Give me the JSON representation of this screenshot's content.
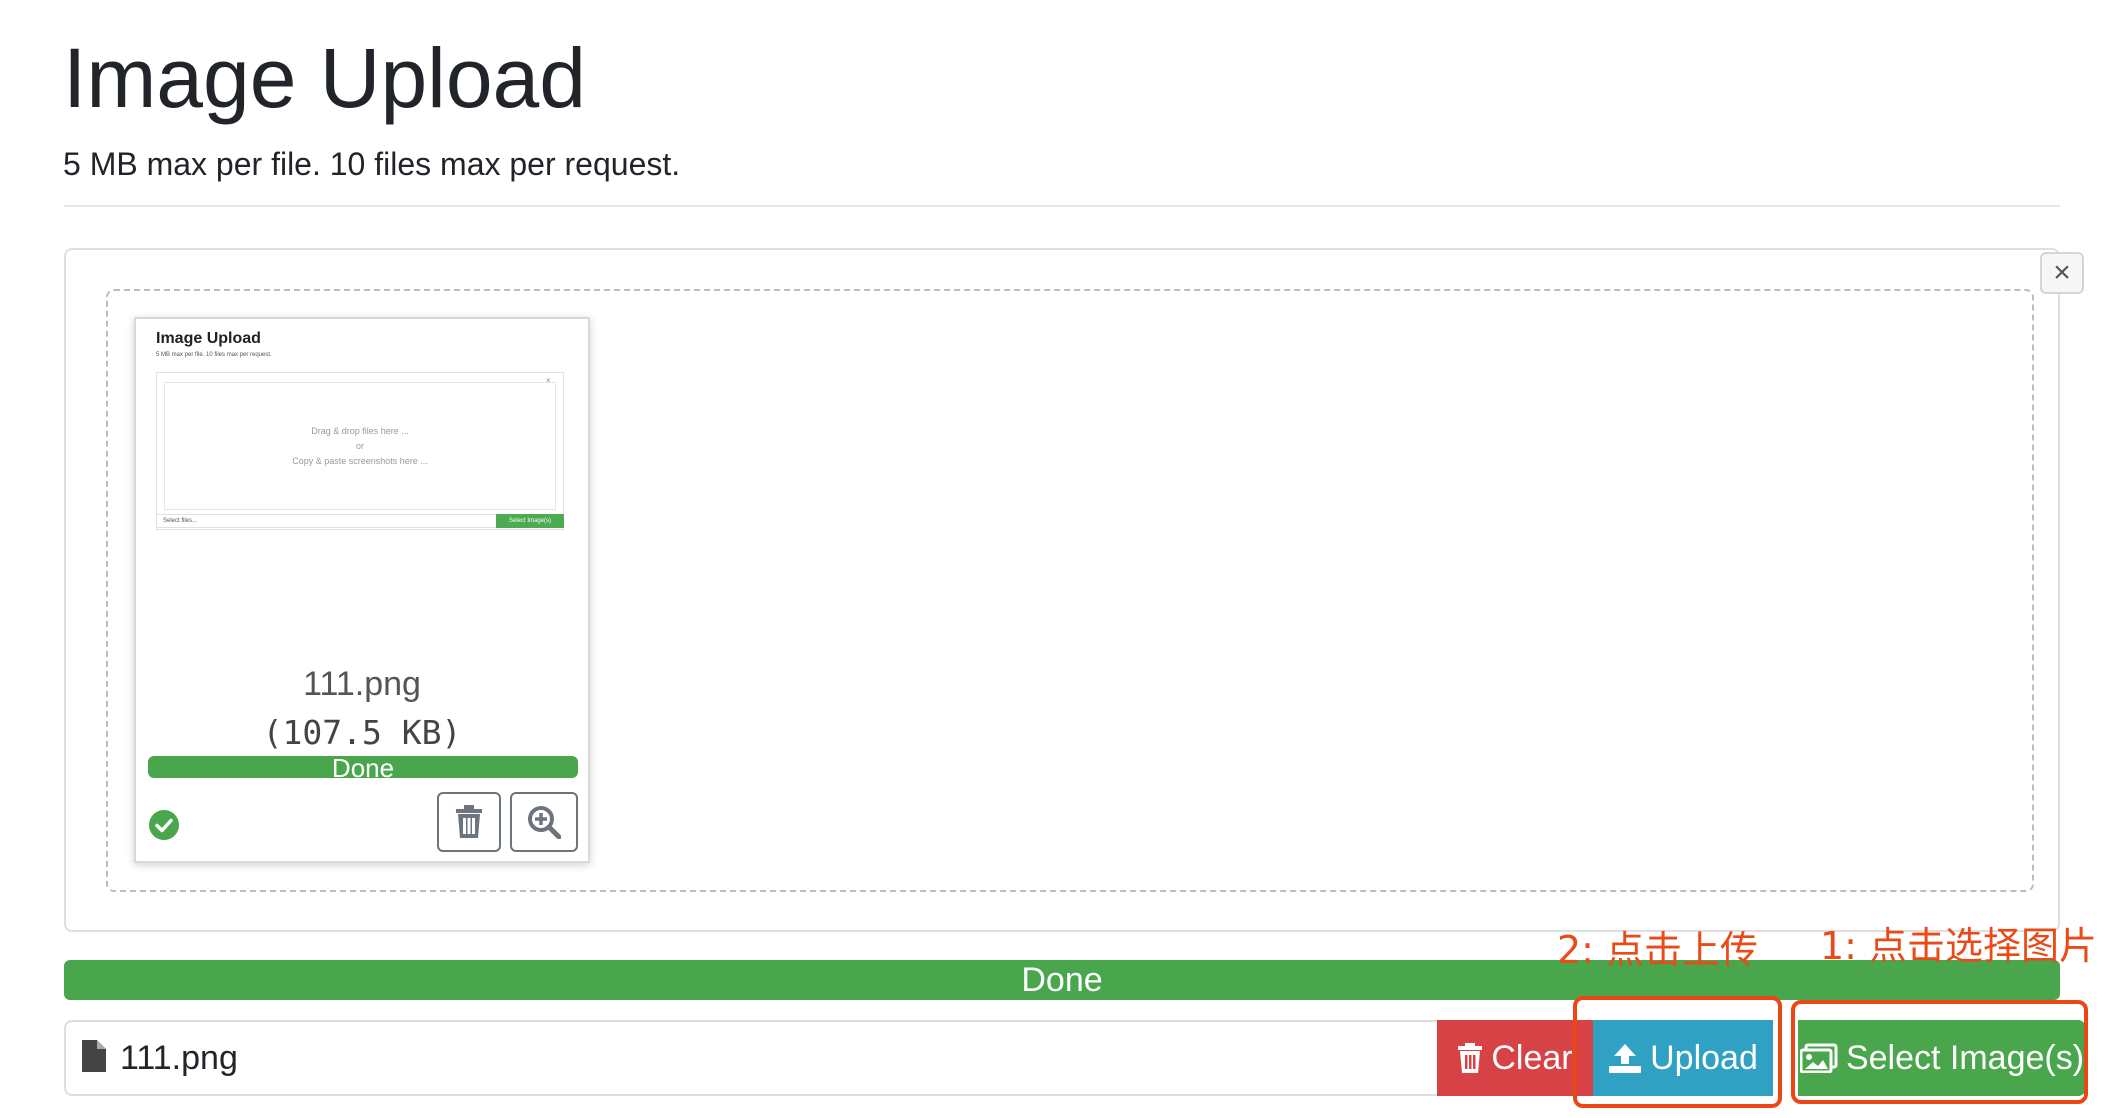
{
  "page": {
    "title": "Image Upload",
    "lead": "5 MB max per file. 10 files max per request."
  },
  "close_button": {
    "label": "×"
  },
  "thumbnail": {
    "preview": {
      "title": "Image Upload",
      "lead": "5 MB max per file. 10 files max per request.",
      "drop_line1": "Drag & drop files here ...",
      "drop_or": "or",
      "drop_line2": "Copy & paste screenshots here ...",
      "caption": "Select files...",
      "button": "Select Image(s)"
    },
    "file_name": "111.png",
    "file_size": "(107.5 KB)",
    "progress_label": "Done",
    "progress_percent": 100
  },
  "main_progress": {
    "label": "Done",
    "percent": 100
  },
  "caption": {
    "file_name": "111.png"
  },
  "buttons": {
    "clear": "Clear",
    "upload": "Upload",
    "select": "Select Image(s)"
  },
  "annotations": {
    "step2": "2: 点击上传",
    "step1": "1: 点击选择图片",
    "color": "#eb4715"
  },
  "colors": {
    "success": "#4aa64d",
    "danger": "#d64245",
    "info": "#30a0c3"
  }
}
